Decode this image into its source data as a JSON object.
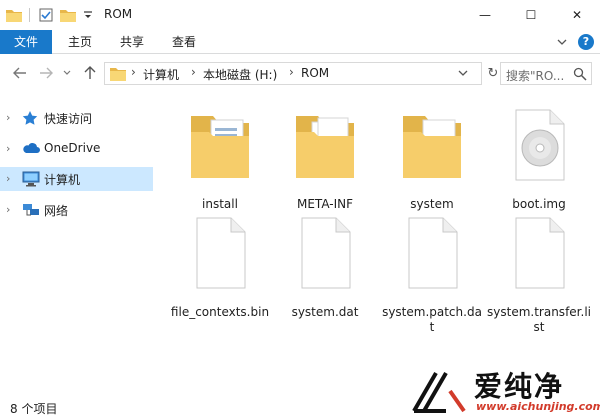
{
  "window": {
    "title": "ROM",
    "minimize_glyph": "—",
    "maximize_glyph": "☐",
    "close_glyph": "✕"
  },
  "ribbon": {
    "tabs": [
      "文件",
      "主页",
      "共享",
      "查看"
    ],
    "accent_color": "#1979ca",
    "help_glyph": "?"
  },
  "address_bar": {
    "breadcrumbs": [
      "计算机",
      "本地磁盘 (H:)",
      "ROM"
    ],
    "search_placeholder": "搜索\"RO...",
    "refresh_glyph": "↻"
  },
  "nav_pane": {
    "items": [
      {
        "label": "快速访问",
        "icon": "star-icon",
        "selected": false
      },
      {
        "label": "OneDrive",
        "icon": "cloud-icon",
        "selected": false
      },
      {
        "label": "计算机",
        "icon": "computer-icon",
        "selected": true
      },
      {
        "label": "网络",
        "icon": "network-icon",
        "selected": false
      }
    ],
    "selected_color": "#cce8ff"
  },
  "files": [
    {
      "name": "install",
      "type": "folder"
    },
    {
      "name": "META-INF",
      "type": "folder"
    },
    {
      "name": "system",
      "type": "folder"
    },
    {
      "name": "boot.img",
      "type": "disc-image"
    },
    {
      "name": "file_contexts.bin",
      "type": "file"
    },
    {
      "name": "system.dat",
      "type": "file"
    },
    {
      "name": "system.patch.dat",
      "type": "file"
    },
    {
      "name": "system.transfer.list",
      "type": "file"
    }
  ],
  "status_bar": {
    "item_count": "8 个项目"
  },
  "watermark": {
    "brand": "爱纯净",
    "url": "www.aichunjing.com"
  }
}
